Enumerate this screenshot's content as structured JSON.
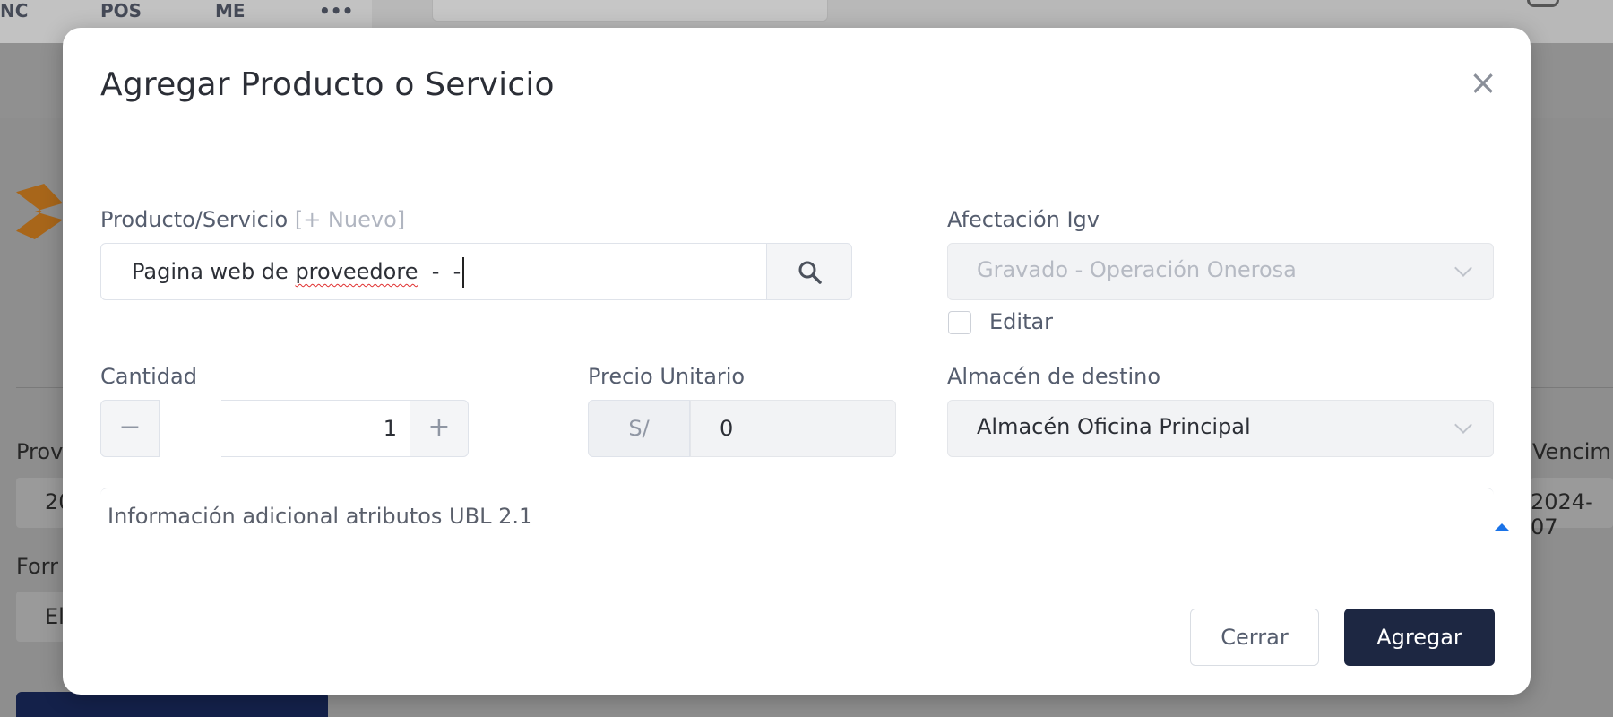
{
  "background": {
    "tabs": [
      "NC",
      "POS",
      "ME",
      "•••"
    ],
    "left_labels": [
      "Prov",
      "20",
      "Forr",
      "El"
    ],
    "right_labels": [
      "Vencim",
      "2024-07"
    ]
  },
  "modal": {
    "title": "Agregar Producto o Servicio",
    "close_icon": "close-icon",
    "product": {
      "label": "Producto/Servicio",
      "new_link": "[+ Nuevo]",
      "value_prefix": "Pagina web de ",
      "value_misspelled": "proveedore",
      "value_suffix": "  -  -",
      "search_icon": "search-icon"
    },
    "igv": {
      "label": "Afectación Igv",
      "value": "Gravado - Operación Onerosa",
      "edit_label": "Editar"
    },
    "quantity": {
      "label": "Cantidad",
      "minus": "−",
      "value": "1",
      "plus": "+"
    },
    "unit_price": {
      "label": "Precio Unitario",
      "currency": "S/",
      "value": "0"
    },
    "warehouse": {
      "label": "Almacén de destino",
      "value": "Almacén Oficina Principal"
    },
    "additional_info": {
      "label": "Información adicional atributos UBL 2.1",
      "icon": "caret-up-icon"
    },
    "buttons": {
      "cancel": "Cerrar",
      "submit": "Agregar"
    },
    "colors": {
      "primary": "#1d2742",
      "accent_caret": "#1a73e8",
      "spell_underline": "#e03030"
    }
  }
}
